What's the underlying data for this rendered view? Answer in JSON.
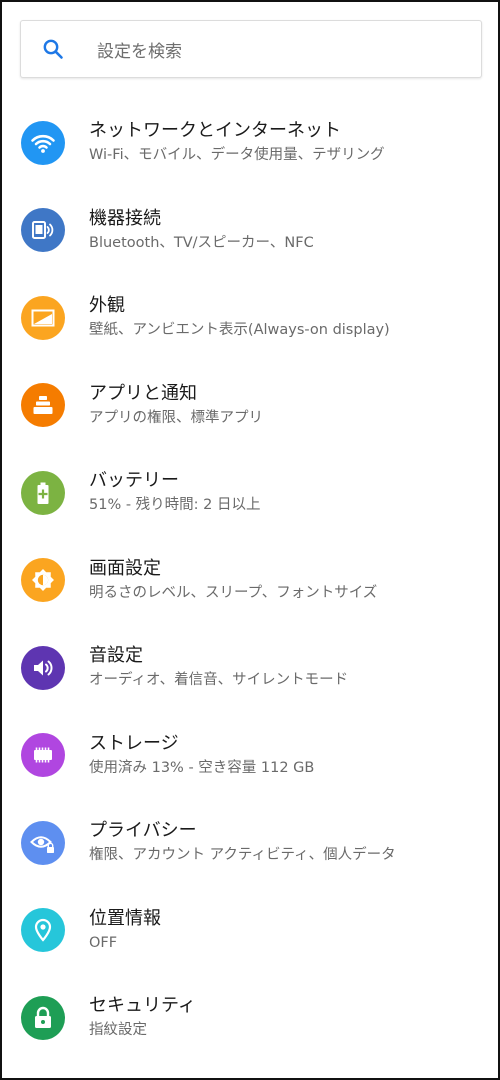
{
  "search": {
    "placeholder": "設定を検索",
    "icon": "search-icon"
  },
  "settings": [
    {
      "id": "network",
      "icon": "wifi-icon",
      "color": "#2196F3",
      "title": "ネットワークとインターネット",
      "subtitle": "Wi-Fi、モバイル、データ使用量、テザリング"
    },
    {
      "id": "devices",
      "icon": "devices-icon",
      "color": "#3F77C6",
      "title": "機器接続",
      "subtitle": "Bluetooth、TV/スピーカー、NFC"
    },
    {
      "id": "display-style",
      "icon": "wallpaper-icon",
      "color": "#FBA520",
      "title": "外観",
      "subtitle": "壁紙、アンビエント表示(Always-on display)"
    },
    {
      "id": "apps",
      "icon": "apps-icon",
      "color": "#F57C00",
      "title": "アプリと通知",
      "subtitle": "アプリの権限、標準アプリ"
    },
    {
      "id": "battery",
      "icon": "battery-icon",
      "color": "#7CB342",
      "title": "バッテリー",
      "subtitle": "51% - 残り時間: 2 日以上"
    },
    {
      "id": "screen",
      "icon": "brightness-icon",
      "color": "#FBA520",
      "title": "画面設定",
      "subtitle": "明るさのレベル、スリープ、フォントサイズ"
    },
    {
      "id": "sound",
      "icon": "volume-icon",
      "color": "#5E35B1",
      "title": "音設定",
      "subtitle": "オーディオ、着信音、サイレントモード"
    },
    {
      "id": "storage",
      "icon": "storage-icon",
      "color": "#B046E0",
      "title": "ストレージ",
      "subtitle": "使用済み 13% - 空き容量 112 GB"
    },
    {
      "id": "privacy",
      "icon": "privacy-eye-icon",
      "color": "#5E8FF0",
      "title": "プライバシー",
      "subtitle": "権限、アカウント アクティビティ、個人データ"
    },
    {
      "id": "location",
      "icon": "location-pin-icon",
      "color": "#26C6DA",
      "title": "位置情報",
      "subtitle": "OFF"
    },
    {
      "id": "security",
      "icon": "lock-icon",
      "color": "#1E9E55",
      "title": "セキュリティ",
      "subtitle": "指紋設定"
    }
  ]
}
